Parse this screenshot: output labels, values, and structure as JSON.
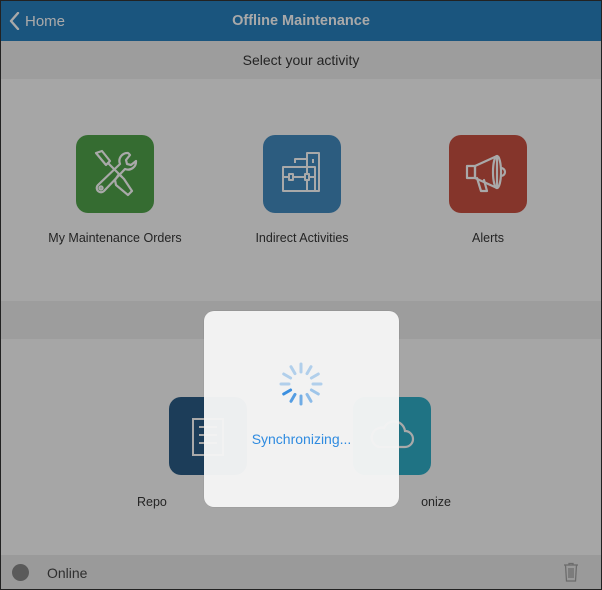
{
  "navbar": {
    "back_label": "Home",
    "title": "Offline Maintenance",
    "color": "#1273b8"
  },
  "header": {
    "prompt": "Select your activity"
  },
  "activities": [
    {
      "label": "My Maintenance Orders",
      "icon": "wrench-screwdriver-icon",
      "color": "#3f9a37"
    },
    {
      "label": "Indirect Activities",
      "icon": "toolbox-icon",
      "color": "#2f7fba"
    },
    {
      "label": "Alerts",
      "icon": "megaphone-icon",
      "color": "#c43e2e"
    },
    {
      "label": "Repo",
      "icon": "report-icon",
      "color": "#144c7a"
    },
    {
      "label": "onize",
      "icon": "cloud-sync-icon",
      "color": "#1aa6c2"
    }
  ],
  "footer": {
    "status": "Online",
    "status_color": "#7c7c7c"
  },
  "sync_dialog": {
    "message": "Synchronizing...",
    "accent": "#2f8be0"
  }
}
